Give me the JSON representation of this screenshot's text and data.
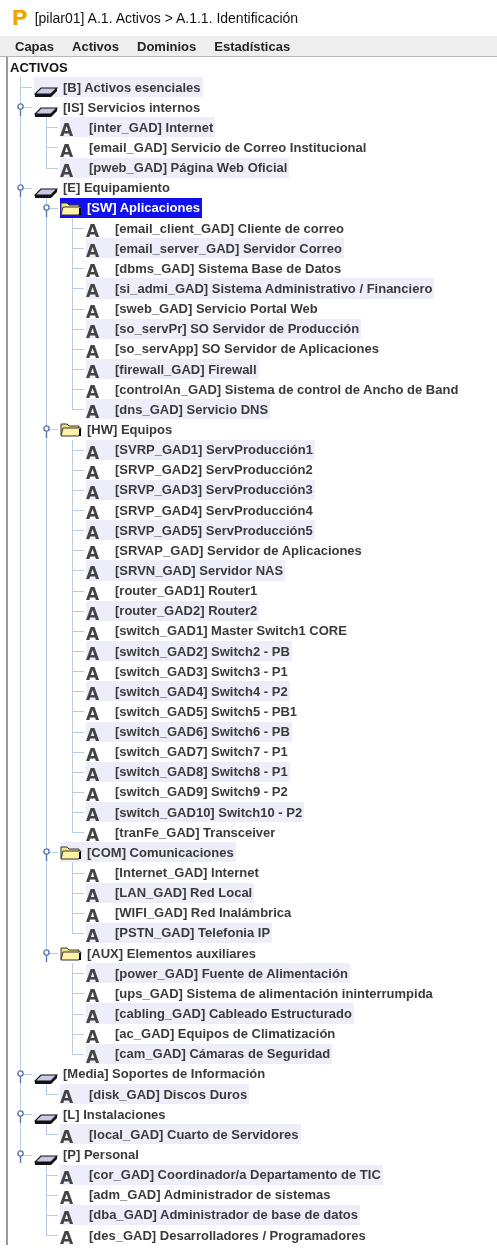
{
  "window": {
    "logo": "P",
    "title": "[pilar01] A.1. Activos > A.1.1. Identificación"
  },
  "menu": [
    {
      "label": "Capas"
    },
    {
      "label": "Activos"
    },
    {
      "label": "Dominios"
    },
    {
      "label": "Estadísticas"
    }
  ],
  "tree": {
    "root": "ACTIVOS",
    "children": [
      {
        "label": "[B] Activos esenciales",
        "kind": "layer",
        "selected": false
      },
      {
        "label": "[IS] Servicios internos",
        "kind": "layer",
        "selected": false,
        "expanded": true,
        "children": [
          {
            "label": "[inter_GAD] Internet",
            "kind": "asset",
            "icon": "A",
            "selected": false
          },
          {
            "label": "[email_GAD] Servicio de Correo Institucional",
            "kind": "asset",
            "icon": "A",
            "selected": false
          },
          {
            "label": "[pweb_GAD] Página Web Oficial",
            "kind": "asset",
            "icon": "A",
            "selected": false
          }
        ]
      },
      {
        "label": "[E] Equipamiento",
        "kind": "layer",
        "selected": false,
        "expanded": true,
        "children": [
          {
            "label": "[SW] Aplicaciones",
            "kind": "folder",
            "selected": true,
            "expanded": true,
            "children": [
              {
                "label": "[email_client_GAD] Cliente de correo",
                "kind": "asset",
                "icon": "A",
                "selected": false
              },
              {
                "label": "[email_server_GAD] Servidor Correo",
                "kind": "asset",
                "icon": "A",
                "selected": false
              },
              {
                "label": "[dbms_GAD] Sistema Base de Datos",
                "kind": "asset",
                "icon": "A",
                "selected": false
              },
              {
                "label": "[si_admi_GAD] Sistema Administrativo / Financiero",
                "kind": "asset",
                "icon": "A",
                "selected": false
              },
              {
                "label": "[sweb_GAD] Servicio Portal Web",
                "kind": "asset",
                "icon": "A",
                "selected": false
              },
              {
                "label": "[so_servPr] SO Servidor de Producción",
                "kind": "asset",
                "icon": "A",
                "selected": false
              },
              {
                "label": "[so_servApp] SO Servidor de Aplicaciones",
                "kind": "asset",
                "icon": "A",
                "selected": false
              },
              {
                "label": "[firewall_GAD] Firewall",
                "kind": "asset",
                "icon": "A",
                "selected": false
              },
              {
                "label": "[controlAn_GAD] Sistema de control de Ancho de Band",
                "kind": "asset",
                "icon": "A",
                "selected": false
              },
              {
                "label": "[dns_GAD] Servicio DNS",
                "kind": "asset",
                "icon": "A",
                "selected": false
              }
            ]
          },
          {
            "label": "[HW] Equipos",
            "kind": "folder",
            "selected": false,
            "expanded": true,
            "children": [
              {
                "label": "[SVRP_GAD1] ServProducción1",
                "kind": "asset",
                "icon": "A",
                "selected": false
              },
              {
                "label": "[SRVP_GAD2] ServProducción2",
                "kind": "asset",
                "icon": "A",
                "selected": false
              },
              {
                "label": "[SRVP_GAD3] ServProducción3",
                "kind": "asset",
                "icon": "A",
                "selected": false
              },
              {
                "label": "[SRVP_GAD4] ServProducción4",
                "kind": "asset",
                "icon": "A",
                "selected": false
              },
              {
                "label": "[SRVP_GAD5] ServProducción5",
                "kind": "asset",
                "icon": "A",
                "selected": false
              },
              {
                "label": "[SRVAP_GAD] Servidor de Aplicaciones",
                "kind": "asset",
                "icon": "A",
                "selected": false
              },
              {
                "label": "[SRVN_GAD] Servidor NAS",
                "kind": "asset",
                "icon": "A",
                "selected": false
              },
              {
                "label": "[router_GAD1] Router1",
                "kind": "asset",
                "icon": "A",
                "selected": false
              },
              {
                "label": "[router_GAD2] Router2",
                "kind": "asset",
                "icon": "A",
                "selected": false
              },
              {
                "label": "[switch_GAD1] Master Switch1 CORE",
                "kind": "asset",
                "icon": "A",
                "selected": false
              },
              {
                "label": "[switch_GAD2] Switch2 - PB",
                "kind": "asset",
                "icon": "A",
                "selected": false
              },
              {
                "label": "[switch_GAD3] Switch3 - P1",
                "kind": "asset",
                "icon": "A",
                "selected": false
              },
              {
                "label": "[switch_GAD4] Switch4 - P2",
                "kind": "asset",
                "icon": "A",
                "selected": false
              },
              {
                "label": "[switch_GAD5] Switch5 - PB1",
                "kind": "asset",
                "icon": "A",
                "selected": false
              },
              {
                "label": "[switch_GAD6] Switch6 - PB",
                "kind": "asset",
                "icon": "A",
                "selected": false
              },
              {
                "label": "[switch_GAD7] Switch7 - P1",
                "kind": "asset",
                "icon": "A",
                "selected": false
              },
              {
                "label": "[switch_GAD8] Switch8 - P1",
                "kind": "asset",
                "icon": "A",
                "selected": false
              },
              {
                "label": "[switch_GAD9] Switch9 - P2",
                "kind": "asset",
                "icon": "A",
                "selected": false
              },
              {
                "label": "[switch_GAD10] Switch10 - P2",
                "kind": "asset",
                "icon": "A",
                "selected": false
              },
              {
                "label": "[tranFe_GAD] Transceiver",
                "kind": "asset",
                "icon": "A",
                "selected": false
              }
            ]
          },
          {
            "label": "[COM] Comunicaciones",
            "kind": "folder",
            "selected": false,
            "expanded": true,
            "children": [
              {
                "label": "[Internet_GAD] Internet",
                "kind": "asset",
                "icon": "A",
                "selected": false
              },
              {
                "label": "[LAN_GAD] Red Local",
                "kind": "asset",
                "icon": "A",
                "selected": false
              },
              {
                "label": "[WIFI_GAD] Red Inalámbrica",
                "kind": "asset",
                "icon": "A",
                "selected": false
              },
              {
                "label": "[PSTN_GAD] Telefonia IP",
                "kind": "asset",
                "icon": "A",
                "selected": false
              }
            ]
          },
          {
            "label": "[AUX] Elementos auxiliares",
            "kind": "folder",
            "selected": false,
            "expanded": true,
            "children": [
              {
                "label": "[power_GAD] Fuente de Alimentación",
                "kind": "asset",
                "icon": "A",
                "selected": false
              },
              {
                "label": "[ups_GAD] Sistema de alimentación ininterrumpida",
                "kind": "asset",
                "icon": "A",
                "selected": false
              },
              {
                "label": "[cabling_GAD] Cableado Estructurado",
                "kind": "asset",
                "icon": "A",
                "selected": false
              },
              {
                "label": "[ac_GAD] Equipos de Climatización",
                "kind": "asset",
                "icon": "A",
                "selected": false
              },
              {
                "label": "[cam_GAD] Cámaras de Seguridad",
                "kind": "asset",
                "icon": "A",
                "selected": false
              }
            ]
          }
        ]
      },
      {
        "label": "[Media] Soportes de Información",
        "kind": "layer",
        "selected": false,
        "expanded": true,
        "children": [
          {
            "label": "[disk_GAD] Discos Duros",
            "kind": "asset",
            "icon": "A",
            "selected": false
          }
        ]
      },
      {
        "label": "[L] Instalaciones",
        "kind": "layer",
        "selected": false,
        "expanded": true,
        "children": [
          {
            "label": "[local_GAD] Cuarto de Servidores",
            "kind": "asset",
            "icon": "A",
            "selected": false
          }
        ]
      },
      {
        "label": "[P] Personal",
        "kind": "layer",
        "selected": false,
        "expanded": true,
        "children": [
          {
            "label": "[cor_GAD] Coordinador/a Departamento de TIC",
            "kind": "asset",
            "icon": "A",
            "selected": false
          },
          {
            "label": "[adm_GAD] Administrador de sistemas",
            "kind": "asset",
            "icon": "A",
            "selected": false
          },
          {
            "label": "[dba_GAD] Administrador de base de datos",
            "kind": "asset",
            "icon": "A",
            "selected": false
          },
          {
            "label": "[des_GAD] Desarrolladores / Programadores",
            "kind": "asset",
            "icon": "A",
            "selected": false
          }
        ]
      }
    ]
  }
}
